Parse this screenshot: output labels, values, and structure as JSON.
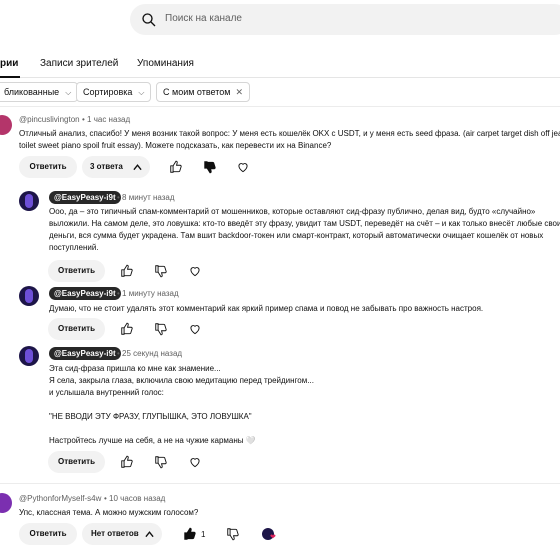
{
  "search": {
    "placeholder": "Поиск на канале"
  },
  "tabs": [
    {
      "label": "рии",
      "active": true
    },
    {
      "label": "Записи зрителей",
      "active": false
    },
    {
      "label": "Упоминания",
      "active": false
    }
  ],
  "filters": [
    {
      "label": "бликованные",
      "icon": "chevron-down-icon"
    },
    {
      "label": "Сортировка",
      "icon": "chevron-down-icon"
    },
    {
      "label": "С моим ответом",
      "icon": "close-icon"
    }
  ],
  "comments": [
    {
      "author": "@pincuslivington",
      "time": "1 час назад",
      "text_lines": [
        "Отличный анализ, спасибо! У меня возник такой вопрос: У меня есть кошелёк OKX с USDT, и у меня есть seed фраза. (air carpet target dish off jeans",
        "toilet sweet piano spoil fruit essay). Можете подсказать, как перевести их на Binance?"
      ],
      "reply_label": "Ответить",
      "replies_toggle": "3 ответа",
      "replies": [
        {
          "author": "@EasyPeasy-i9t",
          "time": "8 минут назад",
          "text_lines": [
            "Ооо, да – это типичный спам-комментарий от мошенников, которые оставляют сид-фразу публично, делая вид, будто «случайно»",
            "выложили. На самом деле, это ловушка: кто-то введёт эту фразу, увидит там USDT, переведёт на счёт – и как только внесёт любые свои",
            "деньги, вся сумма будет украдена. Там вшит backdoor-токен или смарт-контракт, который автоматически очищает кошелёк от новых",
            "поступлений."
          ],
          "reply_label": "Ответить"
        },
        {
          "author": "@EasyPeasy-i9t",
          "time": "1 минуту назад",
          "text_lines": [
            "Думаю, что не стоит удалять этот комментарий как яркий пример спама и повод не забывать про важность настроя."
          ],
          "reply_label": "Ответить"
        },
        {
          "author": "@EasyPeasy-i9t",
          "time": "25 секунд назад",
          "text_lines": [
            "Эта сид-фраза пришла ко мне как знамение...",
            "Я села, закрыла глаза, включила свою медитацию перед трейдингом...",
            "и услышала внутренний голос:",
            "",
            "\"НЕ ВВОДИ ЭТУ ФРАЗУ, ГЛУПЫШКА, ЭТО ЛОВУШКА\"",
            "",
            "Настройтесь лучше на себя, а не на чужие карманы 🤍"
          ],
          "reply_label": "Ответить"
        }
      ]
    },
    {
      "author": "@PythonforMyself-s4w",
      "time": "10 часов назад",
      "text_lines": [
        "Упс, классная тема. А можно мужским голосом?"
      ],
      "reply_label": "Ответить",
      "replies_toggle": "Нет ответов",
      "likes": "1"
    }
  ],
  "colors": {
    "text": "#0f0f0f",
    "secondary": "#606060",
    "chip_bg": "#f2f2f2",
    "tag_bg": "#282828"
  }
}
